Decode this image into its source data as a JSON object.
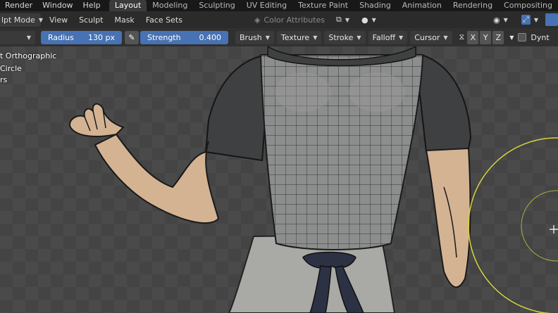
{
  "menus": [
    "Render",
    "Window",
    "Help"
  ],
  "workspaces": [
    "Layout",
    "Modeling",
    "Sculpting",
    "UV Editing",
    "Texture Paint",
    "Shading",
    "Animation",
    "Rendering",
    "Compositing"
  ],
  "active_workspace": "Layout",
  "header": {
    "mode": "lpt Mode",
    "menus": [
      "View",
      "Sculpt",
      "Mask",
      "Face Sets"
    ],
    "color_attributes": "Color Attributes"
  },
  "toolbar": {
    "radius_label": "Radius",
    "radius_value": "130 px",
    "strength_label": "Strength",
    "strength_value": "0.400",
    "dropdowns": [
      "Brush",
      "Texture",
      "Stroke",
      "Falloff",
      "Cursor"
    ],
    "axes": [
      "X",
      "Y",
      "Z"
    ],
    "dyntopo": "Dynt"
  },
  "viewport": {
    "lines": [
      "t Orthographic",
      "Circle",
      "rs"
    ]
  },
  "colors": {
    "accent": "#4772b3",
    "brush_cursor": "#d8d53a"
  }
}
